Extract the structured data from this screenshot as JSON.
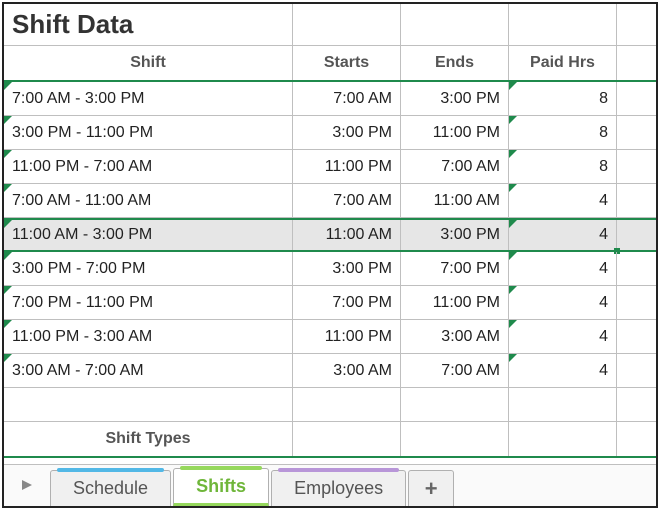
{
  "title": "Shift Data",
  "columns": {
    "shift": "Shift",
    "starts": "Starts",
    "ends": "Ends",
    "paid": "Paid Hrs"
  },
  "rows": [
    {
      "shift": "7:00 AM - 3:00 PM",
      "starts": "7:00 AM",
      "ends": "3:00 PM",
      "paid": "8"
    },
    {
      "shift": "3:00 PM - 11:00 PM",
      "starts": "3:00 PM",
      "ends": "11:00 PM",
      "paid": "8"
    },
    {
      "shift": "11:00 PM - 7:00 AM",
      "starts": "11:00 PM",
      "ends": "7:00 AM",
      "paid": "8"
    },
    {
      "shift": "7:00 AM - 11:00 AM",
      "starts": "7:00 AM",
      "ends": "11:00 AM",
      "paid": "4"
    },
    {
      "shift": "11:00 AM - 3:00 PM",
      "starts": "11:00 AM",
      "ends": "3:00 PM",
      "paid": "4"
    },
    {
      "shift": "3:00 PM - 7:00 PM",
      "starts": "3:00 PM",
      "ends": "7:00 PM",
      "paid": "4"
    },
    {
      "shift": "7:00 PM - 11:00 PM",
      "starts": "7:00 PM",
      "ends": "11:00 PM",
      "paid": "4"
    },
    {
      "shift": "11:00 PM - 3:00 AM",
      "starts": "11:00 PM",
      "ends": "3:00 AM",
      "paid": "4"
    },
    {
      "shift": "3:00 AM - 7:00 AM",
      "starts": "3:00 AM",
      "ends": "7:00 AM",
      "paid": "4"
    }
  ],
  "selected_row_index": 4,
  "section2_title": "Shift Types",
  "tabs": {
    "schedule": "Schedule",
    "shifts": "Shifts",
    "employees": "Employees",
    "add": "+"
  }
}
